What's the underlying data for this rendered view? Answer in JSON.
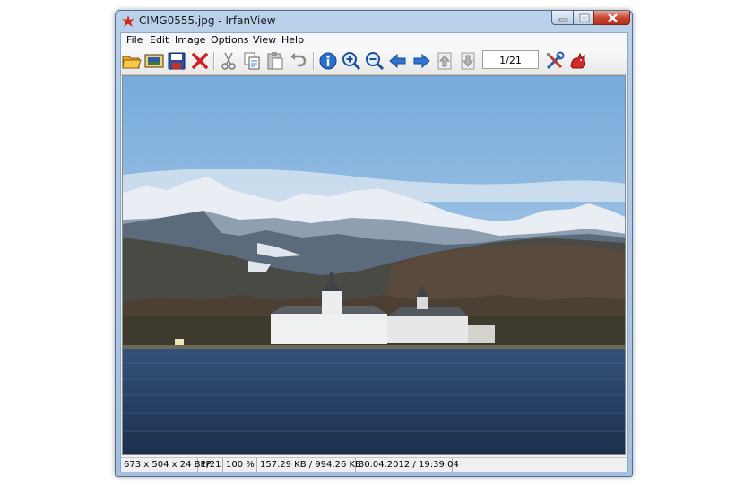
{
  "window": {
    "title": "CIMG0555.jpg - IrfanView"
  },
  "menu": [
    "File",
    "Edit",
    "Image",
    "Options",
    "View",
    "Help"
  ],
  "toolbar": {
    "buttons": [
      {
        "name": "open-folder-icon",
        "interactable": true
      },
      {
        "name": "slideshow-icon",
        "interactable": true
      },
      {
        "name": "save-icon",
        "interactable": true
      },
      {
        "name": "delete-icon",
        "interactable": true
      },
      {
        "name": "cut-icon",
        "interactable": true
      },
      {
        "name": "copy-icon",
        "interactable": true
      },
      {
        "name": "paste-icon",
        "interactable": true
      },
      {
        "name": "undo-icon",
        "interactable": true
      },
      {
        "name": "info-icon",
        "interactable": true
      },
      {
        "name": "zoom-in-icon",
        "interactable": true
      },
      {
        "name": "zoom-out-icon",
        "interactable": true
      },
      {
        "name": "previous-icon",
        "interactable": true
      },
      {
        "name": "next-icon",
        "interactable": true
      },
      {
        "name": "first-image-icon",
        "interactable": true
      },
      {
        "name": "last-image-icon",
        "interactable": true
      },
      {
        "name": "options-tools-icon",
        "interactable": true
      },
      {
        "name": "about-cat-icon",
        "interactable": true
      }
    ],
    "page_indicator": "1/21"
  },
  "status": {
    "dimensions": "673 x 504 x 24 BPP",
    "index": "1/21",
    "zoom": "100 %",
    "size": "157.29 KB / 994.26 KB",
    "datetime": "30.04.2012 / 19:39:04"
  },
  "colors": {
    "sky_top": "#7fb0dc",
    "sky_bottom": "#c9dced",
    "water": "#23395a",
    "mountain_snow": "#e6ecf2",
    "accent_blue": "#2a6fc9"
  }
}
